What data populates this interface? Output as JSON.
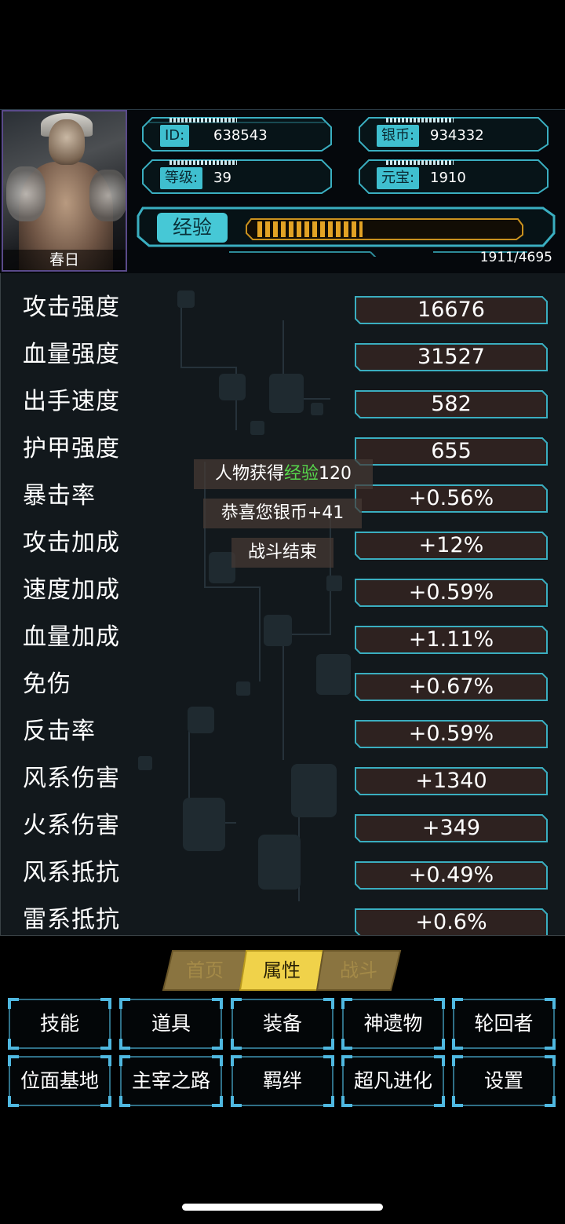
{
  "player": {
    "name": "春日",
    "id_label": "ID:",
    "id_value": "638543",
    "silver_label": "银币:",
    "silver_value": "934332",
    "level_label": "等级:",
    "level_value": "39",
    "gold_label": "元宝:",
    "gold_value": "1910",
    "exp_label": "经验",
    "exp_text": "1911/4695",
    "exp_current": 1911,
    "exp_max": 4695
  },
  "attributes": [
    {
      "name": "攻击强度",
      "value": "16676"
    },
    {
      "name": "血量强度",
      "value": "31527"
    },
    {
      "name": "出手速度",
      "value": "582"
    },
    {
      "name": "护甲强度",
      "value": "655"
    },
    {
      "name": "暴击率",
      "value": "+0.56%"
    },
    {
      "name": "攻击加成",
      "value": "+12%"
    },
    {
      "name": "速度加成",
      "value": "+0.59%"
    },
    {
      "name": "血量加成",
      "value": "+1.11%"
    },
    {
      "name": "免伤",
      "value": "+0.67%"
    },
    {
      "name": "反击率",
      "value": "+0.59%"
    },
    {
      "name": "风系伤害",
      "value": "+1340"
    },
    {
      "name": "火系伤害",
      "value": "+349"
    },
    {
      "name": "风系抵抗",
      "value": "+0.49%"
    },
    {
      "name": "雷系抵抗",
      "value": "+0.6%"
    }
  ],
  "toasts": {
    "exp_prefix": "人物获得",
    "exp_highlight": "经验",
    "exp_amount": "120",
    "silver": "恭喜您银币+41",
    "battle_end": "战斗结束"
  },
  "tabs": [
    {
      "label": "首页",
      "active": false
    },
    {
      "label": "属性",
      "active": true
    },
    {
      "label": "战斗",
      "active": false
    }
  ],
  "menu": [
    {
      "label": "技能"
    },
    {
      "label": "道具"
    },
    {
      "label": "装备"
    },
    {
      "label": "神遗物"
    },
    {
      "label": "轮回者"
    },
    {
      "label": "位面基地"
    },
    {
      "label": "主宰之路"
    },
    {
      "label": "羁绊"
    },
    {
      "label": "超凡进化"
    },
    {
      "label": "设置"
    }
  ],
  "colors": {
    "cyan": "#46c8d6",
    "exp_fill": "#e2a224",
    "value_box": "#2e2220",
    "tab_active": "#f0d24a",
    "tab_inactive": "#8a7440",
    "highlight_green": "#56d64c"
  }
}
